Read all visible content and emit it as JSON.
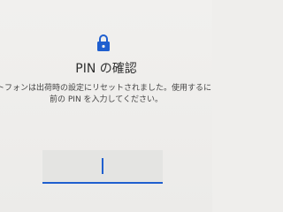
{
  "lock_screen": {
    "icon": "lock-icon",
    "title": "PIN の確認",
    "message_line1": "トフォンは出荷時の設定にリセットされました。使用するに",
    "message_line2": "前の PIN を入力してください。",
    "pin_value": ""
  },
  "colors": {
    "background": "#efeeec",
    "accent": "#1f5fcf",
    "field": "#e4e4e2"
  }
}
